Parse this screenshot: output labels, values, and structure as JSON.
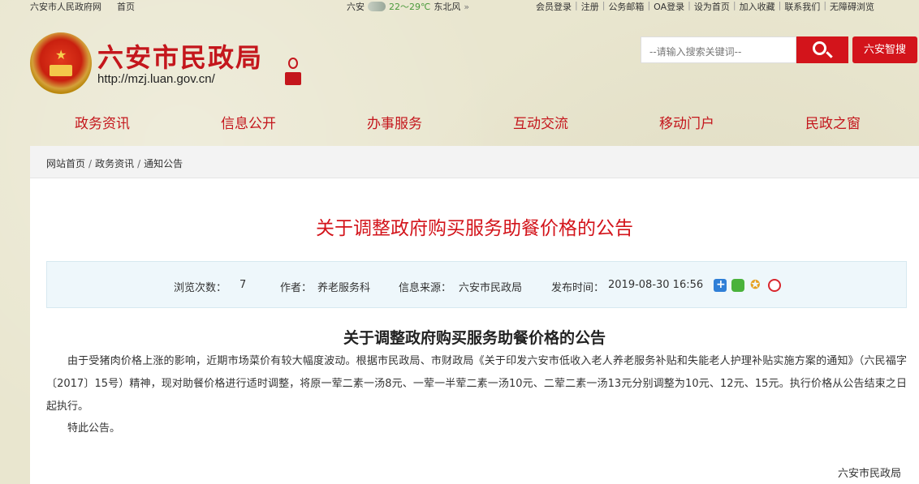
{
  "topbar": {
    "site_name": "六安市人民政府网",
    "home": "首页",
    "weather": {
      "city": "六安",
      "temp": "22～29℃",
      "wind": "东北风",
      "more": "»"
    },
    "links": [
      "会员登录",
      "注册",
      "公务邮箱",
      "OA登录",
      "设为首页",
      "加入收藏",
      "联系我们",
      "无障碍浏览"
    ]
  },
  "header": {
    "title": "六安市民政局",
    "url": "http://mzj.luan.gov.cn/",
    "search_placeholder": "--请输入搜索关键词--",
    "smart_button": "六安智搜"
  },
  "nav": [
    "政务资讯",
    "信息公开",
    "办事服务",
    "互动交流",
    "移动门户",
    "民政之窗"
  ],
  "breadcrumb": [
    "网站首页",
    "政务资讯",
    "通知公告"
  ],
  "article": {
    "title": "关于调整政府购买服务助餐价格的公告",
    "meta": {
      "views_label": "浏览次数：",
      "views": "7",
      "author_label": "作者：",
      "author": "养老服务科",
      "source_label": "信息来源：",
      "source": "六安市民政局",
      "date_label": "发布时间：",
      "date": "2019-08-30 16:56"
    },
    "body_heading": "关于调整政府购买服务助餐价格的公告",
    "paragraph1": "由于受猪肉价格上涨的影响，近期市场菜价有较大幅度波动。根据市民政局、市财政局《关于印发六安市低收入老人养老服务补贴和失能老人护理补贴实施方案的通知》（六民福字〔2017〕15号）精神，现对助餐价格进行适时调整，将原一荤二素一汤8元、一荤一半荤二素一汤10元、二荤二素一汤13元分别调整为10元、12元、15元。执行价格从公告结束之日起执行。",
    "paragraph2": "特此公告。",
    "signature": "六安市民政局"
  },
  "share_icons": [
    "plus-share-icon",
    "wechat-icon",
    "qzone-icon",
    "weibo-icon"
  ]
}
